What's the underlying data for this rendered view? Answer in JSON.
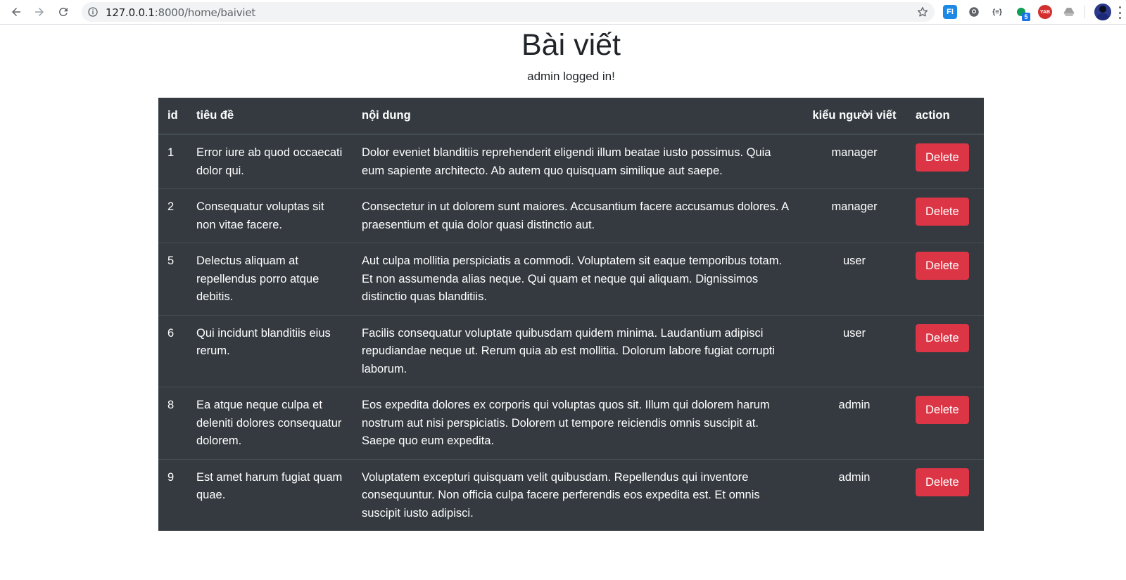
{
  "browser": {
    "url_host": "127.0.0.1",
    "url_path": ":8000/home/baiviet",
    "back_icon": "arrow-left-icon",
    "forward_icon": "arrow-right-icon",
    "reload_icon": "reload-icon",
    "extensions": [
      {
        "name": "fi-extension-icon",
        "label": "FI",
        "color": "#1e88e5"
      },
      {
        "name": "privacy-extension-icon",
        "label": "",
        "color": "#5f6368"
      },
      {
        "name": "json-extension-icon",
        "label": "{≡}",
        "color": "#3c4043"
      },
      {
        "name": "green-extension-icon",
        "label": "",
        "color": "#0f9d58",
        "badge": "5"
      },
      {
        "name": "yab-extension-icon",
        "label": "YAB",
        "color": "#d32f2f"
      },
      {
        "name": "drive-extension-icon",
        "label": "",
        "color": "#9e9e9e"
      }
    ]
  },
  "page": {
    "title": "Bài viết",
    "login_status": "admin logged in!"
  },
  "table": {
    "headers": {
      "id": "id",
      "title": "tiêu đề",
      "content": "nội dung",
      "author_type": "kiểu người viết",
      "action": "action"
    },
    "rows": [
      {
        "id": "1",
        "title": "Error iure ab quod occaecati dolor qui.",
        "content": "Dolor eveniet blanditiis reprehenderit eligendi illum beatae iusto possimus. Quia eum sapiente architecto. Ab autem quo quisquam similique aut saepe.",
        "author_type": "manager",
        "action": "Delete"
      },
      {
        "id": "2",
        "title": "Consequatur voluptas sit non vitae facere.",
        "content": "Consectetur in ut dolorem sunt maiores. Accusantium facere accusamus dolores. A praesentium et quia dolor quasi distinctio aut.",
        "author_type": "manager",
        "action": "Delete"
      },
      {
        "id": "5",
        "title": "Delectus aliquam at repellendus porro atque debitis.",
        "content": "Aut culpa mollitia perspiciatis a commodi. Voluptatem sit eaque temporibus totam. Et non assumenda alias neque. Qui quam et neque qui aliquam. Dignissimos distinctio quas blanditiis.",
        "author_type": "user",
        "action": "Delete"
      },
      {
        "id": "6",
        "title": "Qui incidunt blanditiis eius rerum.",
        "content": "Facilis consequatur voluptate quibusdam quidem minima. Laudantium adipisci repudiandae neque ut. Rerum quia ab est mollitia. Dolorum labore fugiat corrupti laborum.",
        "author_type": "user",
        "action": "Delete"
      },
      {
        "id": "8",
        "title": "Ea atque neque culpa et deleniti dolores consequatur dolorem.",
        "content": "Eos expedita dolores ex corporis qui voluptas quos sit. Illum qui dolorem harum nostrum aut nisi perspiciatis. Dolorem ut tempore reiciendis omnis suscipit at. Saepe quo eum expedita.",
        "author_type": "admin",
        "action": "Delete"
      },
      {
        "id": "9",
        "title": "Est amet harum fugiat quam quae.",
        "content": "Voluptatem excepturi quisquam velit quibusdam. Repellendus qui inventore consequuntur. Non officia culpa facere perferendis eos expedita est. Et omnis suscipit iusto adipisci.",
        "author_type": "admin",
        "action": "Delete"
      }
    ]
  },
  "colors": {
    "table_bg": "#343a40",
    "delete_button": "#dc3545"
  }
}
